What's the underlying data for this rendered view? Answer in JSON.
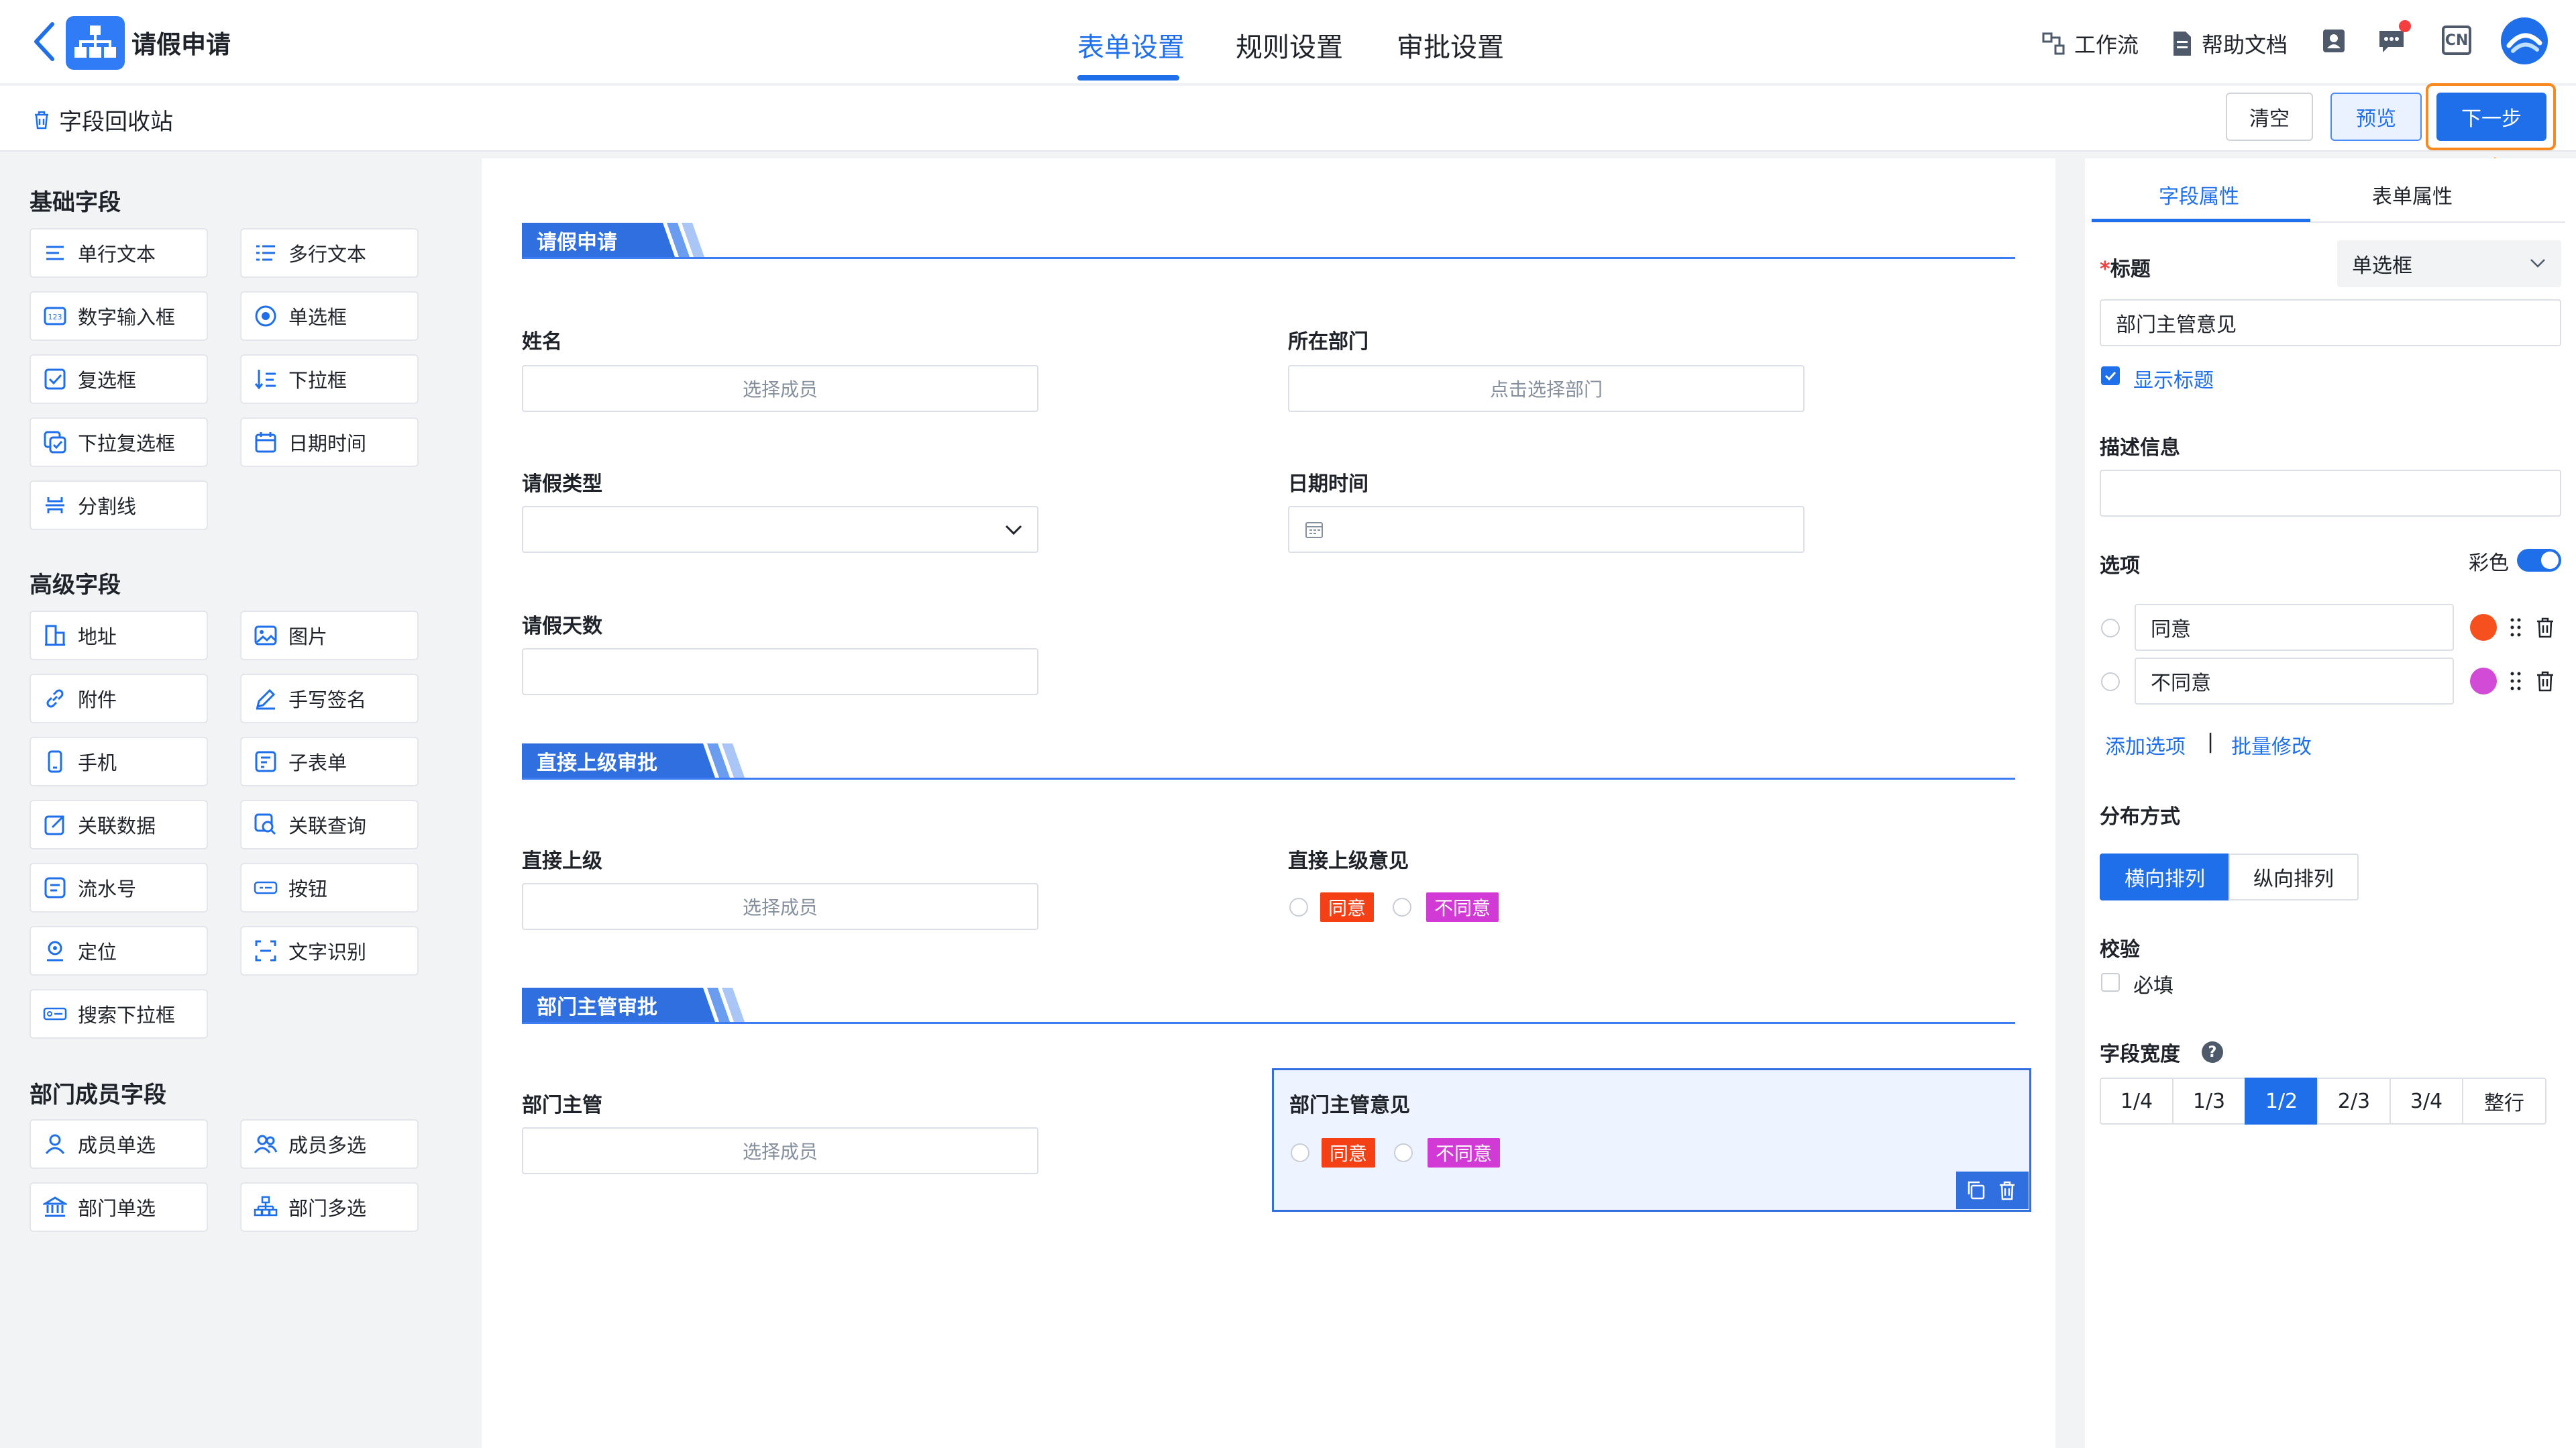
{
  "header": {
    "app_title": "请假申请",
    "tabs": [
      {
        "label": "表单设置",
        "active": true
      },
      {
        "label": "规则设置",
        "active": false
      },
      {
        "label": "审批设置",
        "active": false
      }
    ],
    "tools": {
      "workflow": "工作流",
      "help_docs": "帮助文档",
      "lang": "CN"
    },
    "accent_color": "#1f6feb"
  },
  "subbar": {
    "recycle": "字段回收站",
    "clear": "清空",
    "preview": "预览",
    "next": "下一步"
  },
  "left_panel": {
    "groups": [
      {
        "title": "基础字段",
        "items": [
          "单行文本",
          "多行文本",
          "数字输入框",
          "单选框",
          "复选框",
          "下拉框",
          "下拉复选框",
          "日期时间",
          "分割线"
        ]
      },
      {
        "title": "高级字段",
        "items": [
          "地址",
          "图片",
          "附件",
          "手写签名",
          "手机",
          "子表单",
          "关联数据",
          "关联查询",
          "流水号",
          "按钮",
          "定位",
          "文字识别",
          "搜索下拉框"
        ]
      },
      {
        "title": "部门成员字段",
        "items": [
          "成员单选",
          "成员多选",
          "部门单选",
          "部门多选"
        ]
      }
    ]
  },
  "canvas": {
    "sections": [
      {
        "title": "请假申请"
      },
      {
        "title": "直接上级审批"
      },
      {
        "title": "部门主管审批"
      }
    ],
    "fields": {
      "name_label": "姓名",
      "name_placeholder": "选择成员",
      "dept_label": "所在部门",
      "dept_placeholder": "点击选择部门",
      "leave_type_label": "请假类型",
      "datetime_label": "日期时间",
      "leave_days_label": "请假天数",
      "supervisor_label": "直接上级",
      "supervisor_placeholder": "选择成员",
      "supervisor_opinion_label": "直接上级意见",
      "manager_label": "部门主管",
      "manager_placeholder": "选择成员",
      "manager_opinion_label": "部门主管意见"
    },
    "options": {
      "agree": "同意",
      "disagree": "不同意"
    }
  },
  "right_panel": {
    "tabs": [
      {
        "label": "字段属性",
        "active": true
      },
      {
        "label": "表单属性",
        "active": false
      }
    ],
    "title_label": "标题",
    "required_mark": "*",
    "field_type": "单选框",
    "title_value": "部门主管意见",
    "show_title": "显示标题",
    "desc_label": "描述信息",
    "options_label": "选项",
    "color_toggle_label": "彩色",
    "option_rows": [
      {
        "label": "同意",
        "color": "#f5501e"
      },
      {
        "label": "不同意",
        "color": "#d24bd6"
      }
    ],
    "add_option": "添加选项",
    "divider": "|",
    "batch_edit": "批量修改",
    "layout_label": "分布方式",
    "layout_options": [
      {
        "label": "横向排列",
        "active": true
      },
      {
        "label": "纵向排列",
        "active": false
      }
    ],
    "validation_label": "校验",
    "required_label": "必填",
    "width_label": "字段宽度",
    "width_options": [
      {
        "label": "1/4",
        "active": false
      },
      {
        "label": "1/3",
        "active": false
      },
      {
        "label": "1/2",
        "active": true
      },
      {
        "label": "2/3",
        "active": false
      },
      {
        "label": "3/4",
        "active": false
      },
      {
        "label": "整行",
        "active": false
      }
    ]
  }
}
